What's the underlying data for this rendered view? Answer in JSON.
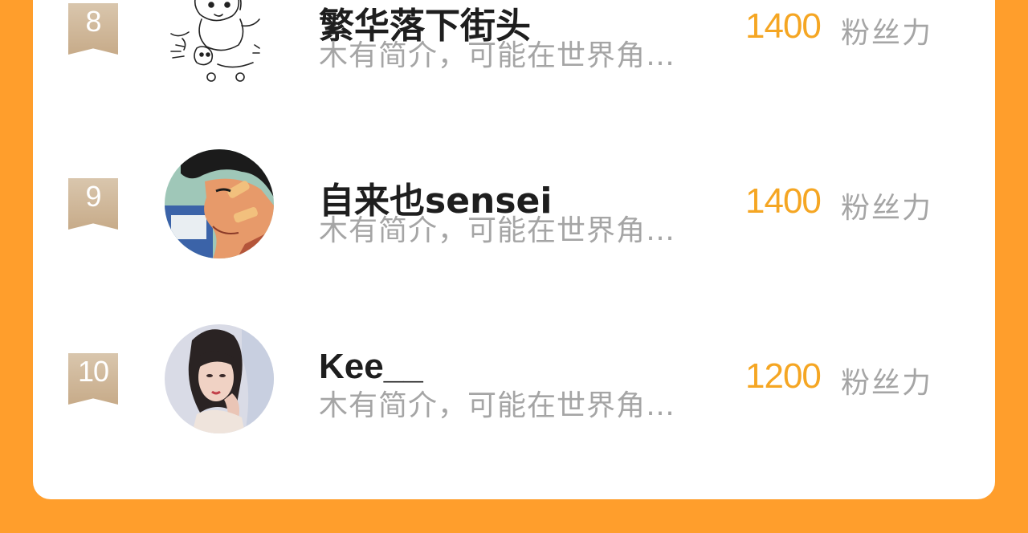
{
  "accent_color": "#FF9E2C",
  "rank_badge_color": "#c7ab89",
  "fans_number_color": "#f5a623",
  "rows": [
    {
      "rank": "8",
      "name": "繁华落下街头",
      "bio": "木有简介，可能在世界角…",
      "fans": "1400",
      "fans_unit": "粉丝力",
      "avatar_icon": "cartoon-sketch-avatar"
    },
    {
      "rank": "9",
      "name": "自来也sensei",
      "bio": "木有简介，可能在世界角…",
      "fans": "1400",
      "fans_unit": "粉丝力",
      "avatar_icon": "anime-character-avatar"
    },
    {
      "rank": "10",
      "name": "Kee__",
      "bio": "木有简介，可能在世界角…",
      "fans": "1200",
      "fans_unit": "粉丝力",
      "avatar_icon": "photo-portrait-avatar"
    }
  ]
}
